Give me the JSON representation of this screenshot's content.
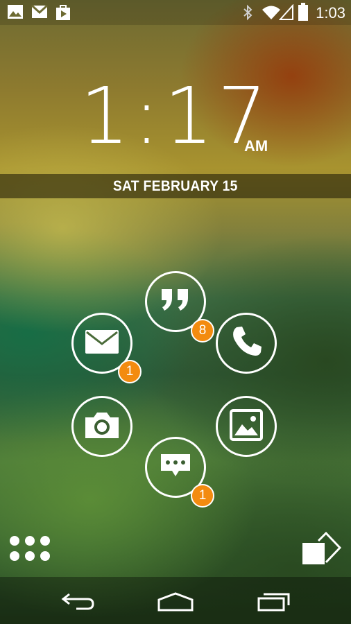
{
  "status_bar": {
    "left_icons": [
      "image-icon",
      "gmail-icon",
      "play-store-icon"
    ],
    "right_icons": [
      "bluetooth-icon",
      "wifi-icon",
      "signal-icon",
      "battery-icon"
    ],
    "time": "1:03"
  },
  "lock_screen": {
    "time": "1:17",
    "ampm": "AM",
    "date": "SAT FEBRUARY 15"
  },
  "apps": [
    {
      "name": "hangouts",
      "icon": "quote-icon",
      "badge": "8"
    },
    {
      "name": "email",
      "icon": "envelope-icon",
      "badge": "1"
    },
    {
      "name": "phone",
      "icon": "phone-icon",
      "badge": ""
    },
    {
      "name": "camera",
      "icon": "camera-icon",
      "badge": ""
    },
    {
      "name": "gallery",
      "icon": "picture-icon",
      "badge": ""
    },
    {
      "name": "messaging",
      "icon": "chat-bubble-icon",
      "badge": "1"
    }
  ],
  "bottom": {
    "left_icon": "app-drawer-icon",
    "right_icon": "unlock-arrow-icon"
  },
  "nav_bar": {
    "icons": [
      "back-icon",
      "home-icon",
      "recents-icon"
    ]
  },
  "colors": {
    "badge": "#f38b10",
    "icon": "#ffffff"
  }
}
